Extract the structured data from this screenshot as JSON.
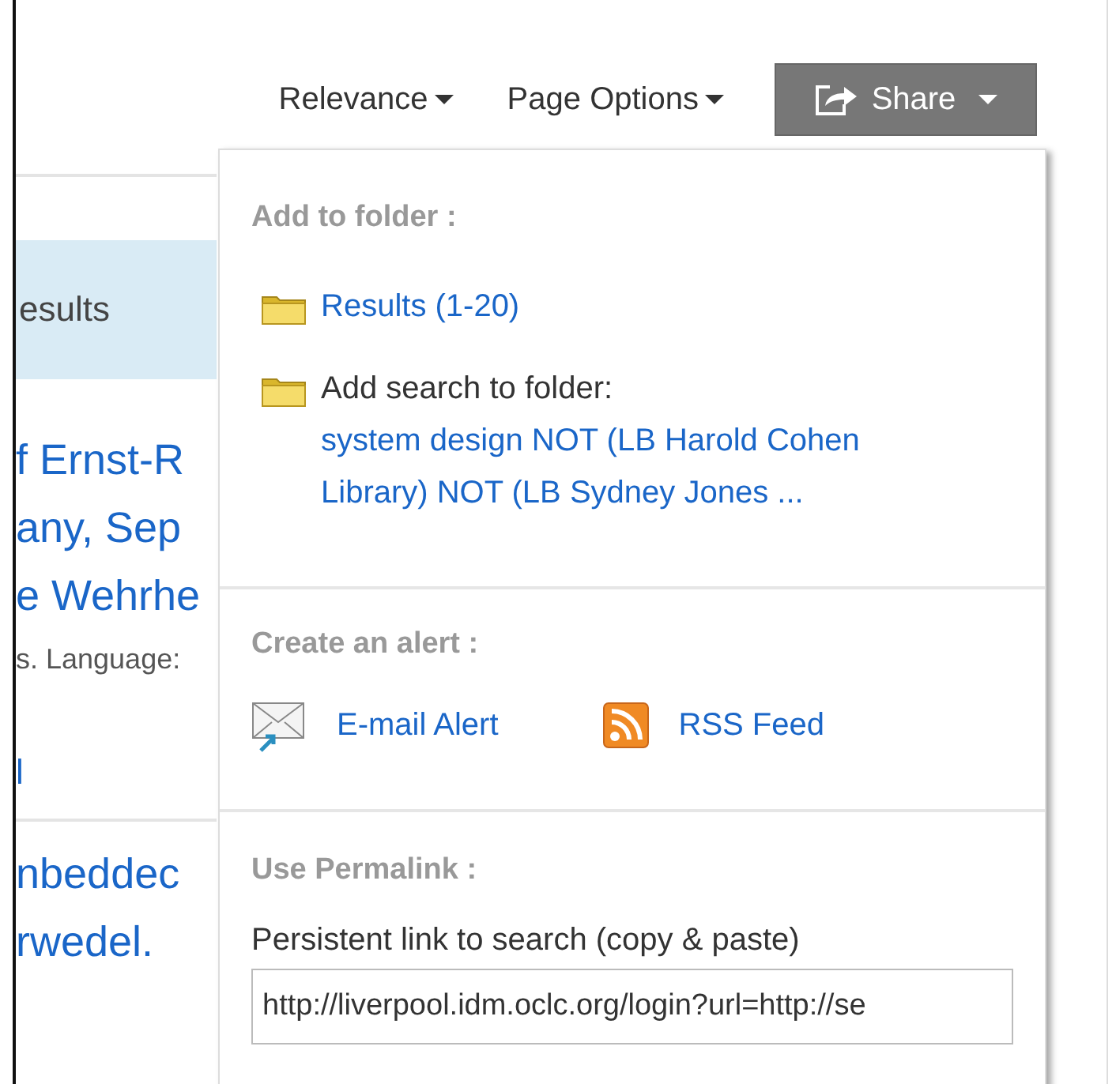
{
  "toolbar": {
    "sort": {
      "label": "Relevance"
    },
    "page_options": {
      "label": "Page Options"
    },
    "share": {
      "label": "Share",
      "expanded": true
    }
  },
  "results": {
    "header": "esults",
    "items": [
      {
        "title_lines": [
          "f Ernst-R",
          "any, Sep",
          "e Wehrhe"
        ],
        "meta": "s. Language:",
        "link": "l"
      },
      {
        "title_lines": [
          "nbeddec",
          "rwedel."
        ]
      }
    ]
  },
  "share_menu": {
    "folder": {
      "heading": "Add to folder :",
      "results_link": "Results (1-20)",
      "search_label": "Add search to folder:",
      "search_link": "system design NOT (LB Harold Cohen Library) NOT (LB Sydney Jones ..."
    },
    "alert": {
      "heading": "Create an alert :",
      "links": [
        {
          "kind": "email",
          "label": "E-mail Alert"
        },
        {
          "kind": "rss",
          "label": "RSS Feed"
        }
      ]
    },
    "permalink": {
      "heading": "Use Permalink :",
      "label": "Persistent link to search (copy & paste)",
      "value": "http://liverpool.idm.oclc.org/login?url=http://se"
    }
  }
}
